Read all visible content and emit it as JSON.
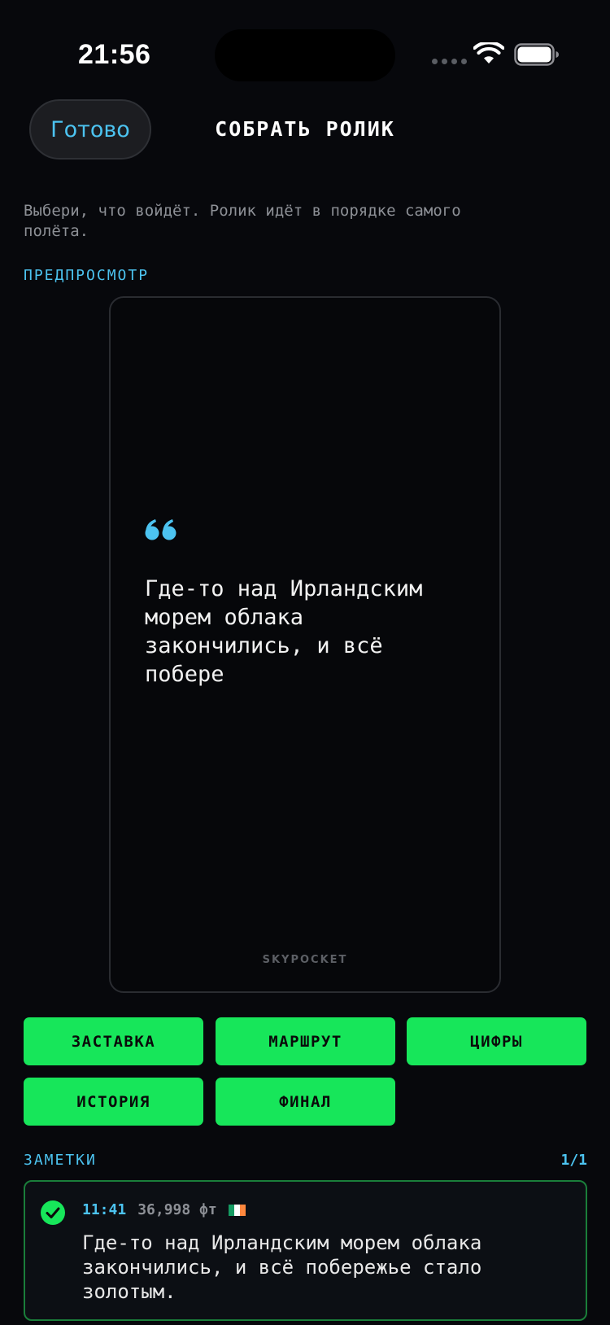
{
  "status_bar": {
    "time": "21:56",
    "icons": [
      "signal-dots-icon",
      "wifi-icon",
      "battery-icon"
    ]
  },
  "nav": {
    "done_label": "Готово",
    "title": "СОБРАТЬ РОЛИК"
  },
  "subtitle": "Выбери, что войдёт. Ролик идёт в порядке самого полёта.",
  "preview": {
    "label": "ПРЕДПРОСМОТР",
    "quote_icon": "quote-icon",
    "quote_text": "Где-то над Ирландским морем облака закончились, и всё побере",
    "watermark": "SKYPOCKET"
  },
  "chips": [
    "ЗАСТАВКА",
    "МАРШРУТ",
    "ЦИФРЫ",
    "ИСТОРИЯ",
    "ФИНАЛ"
  ],
  "notes": {
    "label": "ЗАМЕТКИ",
    "count": "1/1",
    "items": [
      {
        "time": "11:41",
        "altitude": "36,998 фт",
        "flag": "ireland-flag-icon",
        "text": "Где-то над Ирландским морем облака закончились, и всё побережье стало золотым.",
        "selected": true
      }
    ]
  },
  "colors": {
    "background": "#07080c",
    "accent_blue": "#4cc3f0",
    "accent_green": "#17e65a",
    "muted_text": "#8d9096"
  }
}
